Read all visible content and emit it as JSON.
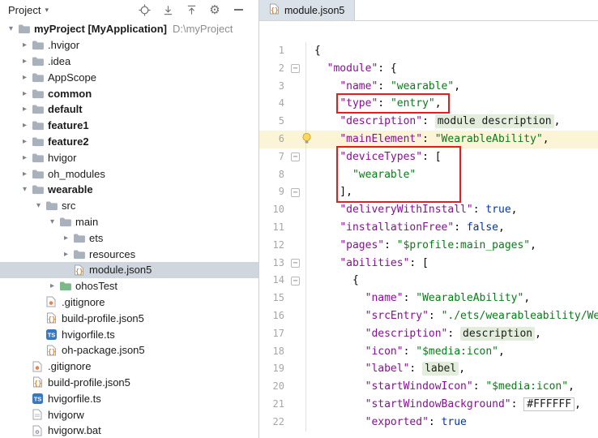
{
  "colors": {
    "key": "#871094",
    "string": "#067d17",
    "keyword": "#0033b3",
    "text": "#080808",
    "folded_bg": "#e2eedb",
    "current_line_bg": "#fbf4d7",
    "annotation_red": "#e02020",
    "tree_selection_bg": "#d0d6dd",
    "tab_bg": "#dbe1e8"
  },
  "projectPanel": {
    "toolbar": {
      "title": "Project",
      "icons": [
        "locate",
        "expand-all",
        "collapse-all",
        "settings",
        "hide"
      ]
    },
    "tree": [
      {
        "id": "root",
        "depth": 0,
        "chevron": "expanded",
        "icon": "folder",
        "label": "myProject [MyApplication]",
        "bold": true,
        "hint": "D:\\myProject"
      },
      {
        "id": "dot-hvigor",
        "depth": 1,
        "chevron": "collapsed",
        "icon": "folder",
        "label": ".hvigor"
      },
      {
        "id": "dot-idea",
        "depth": 1,
        "chevron": "collapsed",
        "icon": "folder",
        "label": ".idea"
      },
      {
        "id": "appscope",
        "depth": 1,
        "chevron": "collapsed",
        "icon": "folder",
        "label": "AppScope"
      },
      {
        "id": "common",
        "depth": 1,
        "chevron": "collapsed",
        "icon": "folder",
        "label": "common",
        "bold": true
      },
      {
        "id": "default",
        "depth": 1,
        "chevron": "collapsed",
        "icon": "folder",
        "label": "default",
        "bold": true
      },
      {
        "id": "feature1",
        "depth": 1,
        "chevron": "collapsed",
        "icon": "folder",
        "label": "feature1",
        "bold": true
      },
      {
        "id": "feature2",
        "depth": 1,
        "chevron": "collapsed",
        "icon": "folder",
        "label": "feature2",
        "bold": true
      },
      {
        "id": "hvigor",
        "depth": 1,
        "chevron": "collapsed",
        "icon": "folder",
        "label": "hvigor"
      },
      {
        "id": "oh-modules",
        "depth": 1,
        "chevron": "collapsed",
        "icon": "folder",
        "label": "oh_modules"
      },
      {
        "id": "wearable",
        "depth": 1,
        "chevron": "expanded",
        "icon": "folder",
        "label": "wearable",
        "bold": true
      },
      {
        "id": "src",
        "depth": 2,
        "chevron": "expanded",
        "icon": "folder",
        "label": "src"
      },
      {
        "id": "main",
        "depth": 3,
        "chevron": "expanded",
        "icon": "folder",
        "label": "main"
      },
      {
        "id": "ets",
        "depth": 4,
        "chevron": "collapsed",
        "icon": "folder",
        "label": "ets"
      },
      {
        "id": "resources",
        "depth": 4,
        "chevron": "collapsed",
        "icon": "folder",
        "label": "resources"
      },
      {
        "id": "module-json5",
        "depth": 4,
        "icon": "json5",
        "label": "module.json5",
        "selected": true
      },
      {
        "id": "ohostest",
        "depth": 3,
        "chevron": "collapsed",
        "icon": "folder-test",
        "label": "ohosTest"
      },
      {
        "id": "wearable-gitignore",
        "depth": 2,
        "icon": "git",
        "label": ".gitignore"
      },
      {
        "id": "wearable-build-profile",
        "depth": 2,
        "icon": "json5",
        "label": "build-profile.json5"
      },
      {
        "id": "wearable-hvigorfile",
        "depth": 2,
        "icon": "ts",
        "label": "hvigorfile.ts"
      },
      {
        "id": "oh-package",
        "depth": 2,
        "icon": "json5",
        "label": "oh-package.json5"
      },
      {
        "id": "gitignore",
        "depth": 1,
        "icon": "git",
        "label": ".gitignore"
      },
      {
        "id": "build-profile",
        "depth": 1,
        "icon": "json5",
        "label": "build-profile.json5"
      },
      {
        "id": "hvigorfile",
        "depth": 1,
        "icon": "ts",
        "label": "hvigorfile.ts"
      },
      {
        "id": "hvigorw",
        "depth": 1,
        "icon": "file",
        "label": "hvigorw"
      },
      {
        "id": "hvigorw-bat",
        "depth": 1,
        "icon": "bat",
        "label": "hvigorw.bat"
      }
    ]
  },
  "editor": {
    "tab": {
      "label": "module.json5",
      "icon": "json5"
    },
    "annotations": [
      {
        "name": "type-entry",
        "around": "\"type\": \"entry\",",
        "lines": "4"
      },
      {
        "name": "device-types",
        "around": "\"deviceTypes\": [ \"wearable\" ],",
        "lines": "7-9"
      }
    ],
    "lines": [
      {
        "num": 1,
        "tokens": [
          {
            "c": "p",
            "t": "{"
          }
        ]
      },
      {
        "num": 2,
        "fold": "start",
        "tokens": [
          {
            "c": "p",
            "t": "  "
          },
          {
            "c": "k",
            "t": "\"module\""
          },
          {
            "c": "p",
            "t": ": {"
          }
        ]
      },
      {
        "num": 3,
        "tokens": [
          {
            "c": "p",
            "t": "    "
          },
          {
            "c": "k",
            "t": "\"name\""
          },
          {
            "c": "p",
            "t": ": "
          },
          {
            "c": "s",
            "t": "\"wearable\""
          },
          {
            "c": "p",
            "t": ","
          }
        ]
      },
      {
        "num": 4,
        "tokens": [
          {
            "c": "p",
            "t": "    "
          },
          {
            "c": "k",
            "t": "\"type\""
          },
          {
            "c": "p",
            "t": ": "
          },
          {
            "c": "s",
            "t": "\"entry\""
          },
          {
            "c": "p",
            "t": ","
          }
        ]
      },
      {
        "num": 5,
        "tokens": [
          {
            "c": "p",
            "t": "    "
          },
          {
            "c": "k",
            "t": "\"description\""
          },
          {
            "c": "p",
            "t": ": "
          },
          {
            "c": "f",
            "t": "module description"
          },
          {
            "c": "p",
            "t": ","
          }
        ]
      },
      {
        "num": 6,
        "current": true,
        "tokens": [
          {
            "c": "p",
            "t": "    "
          },
          {
            "c": "k",
            "t": "\"mainElement\""
          },
          {
            "c": "p",
            "t": ": "
          },
          {
            "c": "s",
            "t": "\"WearableAbility\""
          },
          {
            "c": "p",
            "t": ","
          }
        ]
      },
      {
        "num": 7,
        "fold": "start",
        "tokens": [
          {
            "c": "p",
            "t": "    "
          },
          {
            "c": "k",
            "t": "\"deviceTypes\""
          },
          {
            "c": "p",
            "t": ": ["
          }
        ]
      },
      {
        "num": 8,
        "tokens": [
          {
            "c": "p",
            "t": "      "
          },
          {
            "c": "s",
            "t": "\"wearable\""
          }
        ]
      },
      {
        "num": 9,
        "fold": "end",
        "tokens": [
          {
            "c": "p",
            "t": "    ],"
          }
        ]
      },
      {
        "num": 10,
        "tokens": [
          {
            "c": "p",
            "t": "    "
          },
          {
            "c": "k",
            "t": "\"deliveryWithInstall\""
          },
          {
            "c": "p",
            "t": ": "
          },
          {
            "c": "b",
            "t": "true"
          },
          {
            "c": "p",
            "t": ","
          }
        ]
      },
      {
        "num": 11,
        "tokens": [
          {
            "c": "p",
            "t": "    "
          },
          {
            "c": "k",
            "t": "\"installationFree\""
          },
          {
            "c": "p",
            "t": ": "
          },
          {
            "c": "b",
            "t": "false"
          },
          {
            "c": "p",
            "t": ","
          }
        ]
      },
      {
        "num": 12,
        "tokens": [
          {
            "c": "p",
            "t": "    "
          },
          {
            "c": "k",
            "t": "\"pages\""
          },
          {
            "c": "p",
            "t": ": "
          },
          {
            "c": "s",
            "t": "\"$profile:main_pages\""
          },
          {
            "c": "p",
            "t": ","
          }
        ]
      },
      {
        "num": 13,
        "fold": "start",
        "tokens": [
          {
            "c": "p",
            "t": "    "
          },
          {
            "c": "k",
            "t": "\"abilities\""
          },
          {
            "c": "p",
            "t": ": ["
          }
        ]
      },
      {
        "num": 14,
        "fold": "start",
        "tokens": [
          {
            "c": "p",
            "t": "      {"
          }
        ]
      },
      {
        "num": 15,
        "tokens": [
          {
            "c": "p",
            "t": "        "
          },
          {
            "c": "k",
            "t": "\"name\""
          },
          {
            "c": "p",
            "t": ": "
          },
          {
            "c": "s",
            "t": "\"WearableAbility\""
          },
          {
            "c": "p",
            "t": ","
          }
        ]
      },
      {
        "num": 16,
        "tokens": [
          {
            "c": "p",
            "t": "        "
          },
          {
            "c": "k",
            "t": "\"srcEntry\""
          },
          {
            "c": "p",
            "t": ": "
          },
          {
            "c": "s",
            "t": "\"./ets/wearableability/Wear"
          }
        ]
      },
      {
        "num": 17,
        "tokens": [
          {
            "c": "p",
            "t": "        "
          },
          {
            "c": "k",
            "t": "\"description\""
          },
          {
            "c": "p",
            "t": ": "
          },
          {
            "c": "f",
            "t": "description"
          },
          {
            "c": "p",
            "t": ","
          }
        ]
      },
      {
        "num": 18,
        "tokens": [
          {
            "c": "p",
            "t": "        "
          },
          {
            "c": "k",
            "t": "\"icon\""
          },
          {
            "c": "p",
            "t": ": "
          },
          {
            "c": "s",
            "t": "\"$media:icon\""
          },
          {
            "c": "p",
            "t": ","
          }
        ]
      },
      {
        "num": 19,
        "tokens": [
          {
            "c": "p",
            "t": "        "
          },
          {
            "c": "k",
            "t": "\"label\""
          },
          {
            "c": "p",
            "t": ": "
          },
          {
            "c": "f",
            "t": "label"
          },
          {
            "c": "p",
            "t": ","
          }
        ]
      },
      {
        "num": 20,
        "tokens": [
          {
            "c": "p",
            "t": "        "
          },
          {
            "c": "k",
            "t": "\"startWindowIcon\""
          },
          {
            "c": "p",
            "t": ": "
          },
          {
            "c": "s",
            "t": "\"$media:icon\""
          },
          {
            "c": "p",
            "t": ","
          }
        ]
      },
      {
        "num": 21,
        "tokens": [
          {
            "c": "p",
            "t": "        "
          },
          {
            "c": "k",
            "t": "\"startWindowBackground\""
          },
          {
            "c": "p",
            "t": ": "
          },
          {
            "c": "c",
            "t": "#FFFFFF"
          },
          {
            "c": "p",
            "t": ","
          }
        ]
      },
      {
        "num": 22,
        "tokens": [
          {
            "c": "p",
            "t": "        "
          },
          {
            "c": "k",
            "t": "\"exported\""
          },
          {
            "c": "p",
            "t": ": "
          },
          {
            "c": "b",
            "t": "true"
          }
        ]
      }
    ]
  }
}
